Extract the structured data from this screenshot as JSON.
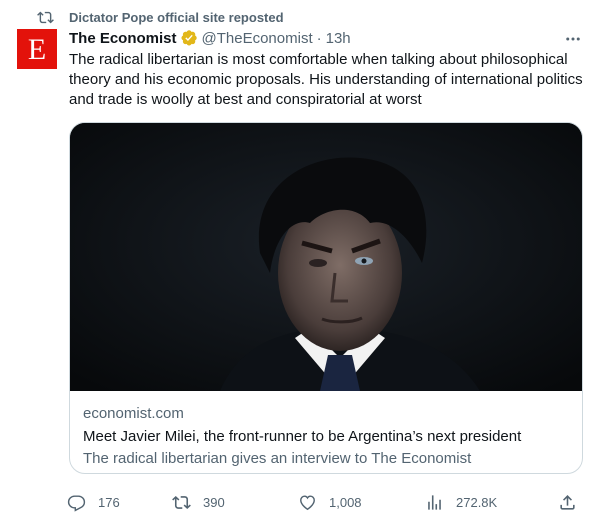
{
  "repost": {
    "icon": "repost-icon",
    "text": "Dictator Pope official site reposted"
  },
  "tweet": {
    "avatar_letter": "E",
    "avatar_color": "#e3120b",
    "display_name": "The Economist",
    "verified_icon": "verified-gold-badge-icon",
    "verified_color": "#e2b719",
    "handle": "@TheEconomist",
    "separator": "·",
    "time": "13h",
    "text": "The radical libertarian is most comfortable when talking about philosophical theory and his economic proposals. His understanding of international politics and trade is woolly at best and conspiratorial at worst",
    "more_icon": "more-dots-icon"
  },
  "card": {
    "image_alt": "photo-portrait",
    "domain": "economist.com",
    "title": "Meet Javier Milei, the front-runner to be Argentina’s next president",
    "description": "The radical libertarian gives an interview to The Economist"
  },
  "actions": {
    "reply": {
      "icon": "reply-icon",
      "count": "176"
    },
    "repost": {
      "icon": "repost-icon",
      "count": "390"
    },
    "like": {
      "icon": "heart-icon",
      "count": "1,008"
    },
    "views": {
      "icon": "views-icon",
      "count": "272.8K"
    },
    "share": {
      "icon": "share-icon"
    }
  },
  "colors": {
    "text": "#0f1419",
    "secondary": "#536471",
    "border": "#cfd9de"
  }
}
